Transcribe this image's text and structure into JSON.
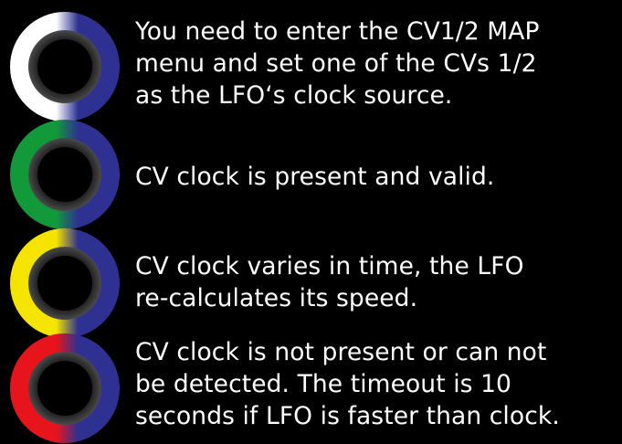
{
  "items": [
    {
      "text": "You need to enter the CV1/2 MAP\nmenu and set one of the CVs 1/2\nas the LFO‘s clock source.",
      "ring_color": "#ffffff",
      "split_color": "#2e3192",
      "state": "no-clock-source"
    },
    {
      "text": "CV clock is present and valid.",
      "ring_color": "#129a3a",
      "split_color": "#2e3192",
      "state": "clock-valid"
    },
    {
      "text": "CV clock varies in time, the LFO\nre-calculates its speed.",
      "ring_color": "#f5e400",
      "split_color": "#2e3192",
      "state": "clock-varying"
    },
    {
      "text": "CV clock is not present or can not\nbe detected. The timeout is 10\nseconds if LFO is faster than clock.",
      "ring_color": "#e8141c",
      "split_color": "#2e3192",
      "state": "clock-missing"
    }
  ]
}
